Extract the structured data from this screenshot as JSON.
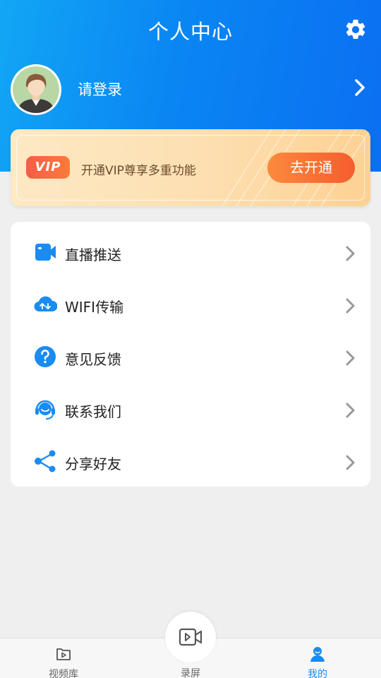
{
  "header": {
    "title": "个人中心",
    "settings_icon": "gear-icon",
    "background_color": "#0a86f3"
  },
  "profile": {
    "avatar_icon": "user-avatar-icon",
    "login_label": "请登录",
    "chevron_icon": "chevron-right-icon"
  },
  "vip": {
    "badge": "VIP",
    "description": "开通VIP尊享多重功能",
    "button_label": "去开通",
    "accent_color": "#f55d2e"
  },
  "menu": {
    "items": [
      {
        "label": "直播推送",
        "icon": "video-camera-icon"
      },
      {
        "label": "WIFI传输",
        "icon": "cloud-transfer-icon"
      },
      {
        "label": "意见反馈",
        "icon": "question-icon"
      },
      {
        "label": "联系我们",
        "icon": "headset-icon"
      },
      {
        "label": "分享好友",
        "icon": "share-icon"
      }
    ]
  },
  "tabbar": {
    "tabs": [
      {
        "label": "视频库",
        "icon": "video-library-icon",
        "active": false
      },
      {
        "label": "录屏",
        "icon": "record-screen-icon",
        "active": false
      },
      {
        "label": "我的",
        "icon": "user-icon",
        "active": true
      }
    ],
    "active_color": "#1a8cf0"
  }
}
